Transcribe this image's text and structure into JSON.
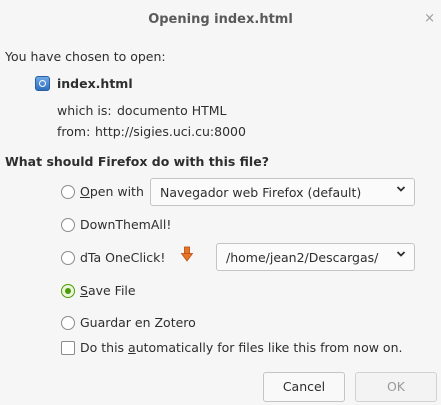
{
  "dialog": {
    "title": "Opening index.html",
    "close_glyph": "×",
    "intro": "You have chosen to open:",
    "file_icon": "html-file-icon",
    "file_name": "index.html",
    "which_is_label": "which is:",
    "which_is_value": "documento HTML",
    "from_label": "from:",
    "from_value": "http://sigies.uci.cu:8000",
    "question": "What should Firefox do with this file?"
  },
  "options": {
    "open_with": {
      "key": "O",
      "rest": "pen with",
      "selected": false,
      "app": "Navegador web Firefox (default)"
    },
    "downthemall": {
      "label": "DownThemAll!",
      "selected": false
    },
    "dta_oneclick": {
      "label": "dTa OneClick!",
      "selected": false,
      "icon": "dta-arrow-icon",
      "folder": "/home/jean2/Descargas/"
    },
    "save_file": {
      "key": "S",
      "rest": "ave File",
      "selected": true
    },
    "zotero": {
      "label": "Guardar en Zotero",
      "selected": false
    }
  },
  "auto": {
    "pre": "Do this ",
    "key": "a",
    "post": "utomatically for files like this from now on.",
    "checked": false
  },
  "buttons": {
    "cancel": "Cancel",
    "ok": "OK",
    "ok_disabled": true
  },
  "colors": {
    "accent_green": "#4e9a06",
    "text": "#2e2e2e",
    "disabled": "#9a9a9a"
  }
}
